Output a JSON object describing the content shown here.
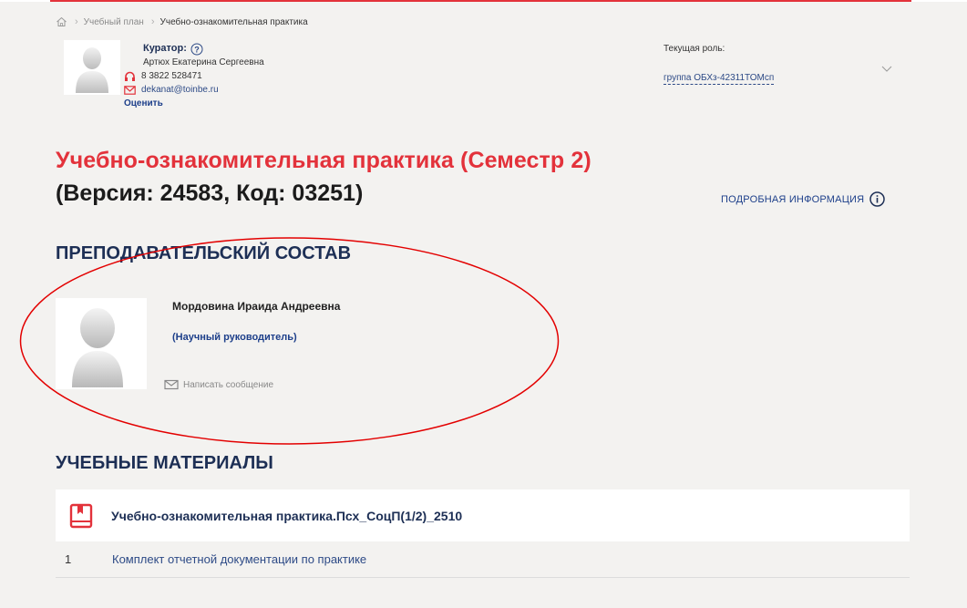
{
  "breadcrumb": {
    "items": [
      "Учебный план",
      "Учебно-ознакомительная практика"
    ]
  },
  "curator": {
    "label": "Куратор:",
    "name": "Артюх Екатерина Сергеевна",
    "phone": "8 3822 528471",
    "email": "dekanat@toinbe.ru",
    "rate_label": "Оценить"
  },
  "role": {
    "label": "Текущая роль:",
    "value": "группа ОБХз-42311ТОМсп"
  },
  "course": {
    "title": "Учебно-ознакомительная практика (Семестр 2)",
    "version": "(Версия: 24583, Код: 03251)",
    "details_link": "ПОДРОБНАЯ ИНФОРМАЦИЯ"
  },
  "staff": {
    "section_title": "ПРЕПОДАВАТЕЛЬСКИЙ СОСТАВ",
    "teacher_name": "Мордовина Ираида Андреевна",
    "teacher_role": "(Научный руководитель)",
    "message_link": "Написать сообщение"
  },
  "materials": {
    "section_title": "УЧЕБНЫЕ МАТЕРИАЛЫ",
    "header": "Учебно-ознакомительная практика.Псх_СоцП(1/2)_2510",
    "rows": [
      {
        "num": "1",
        "title": "Комплект отчетной документации по практике"
      }
    ]
  },
  "colors": {
    "accent_red": "#e3323b",
    "navy": "#1d2f55",
    "link_blue": "#2d4a86",
    "background": "#f3f2f0"
  }
}
